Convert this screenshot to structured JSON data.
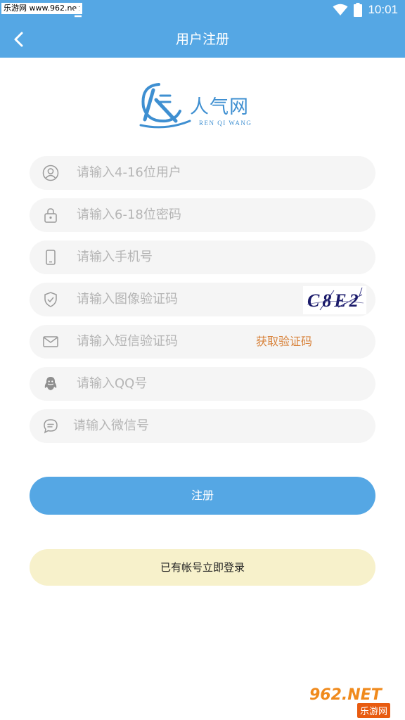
{
  "status_bar": {
    "watermark": "乐游网 www.962.net",
    "time": "10:01"
  },
  "header": {
    "title": "用户注册"
  },
  "logo": {
    "name": "人气网",
    "subtitle": "REN QI WANG"
  },
  "form": {
    "fields": [
      {
        "placeholder": "请输入4-16位用户",
        "icon": "user-icon"
      },
      {
        "placeholder": "请输入6-18位密码",
        "icon": "lock-icon"
      },
      {
        "placeholder": "请输入手机号",
        "icon": "phone-icon"
      },
      {
        "placeholder": "请输入图像验证码",
        "icon": "shield-icon"
      },
      {
        "placeholder": "请输入短信验证码",
        "icon": "mail-icon"
      },
      {
        "placeholder": "请输入QQ号",
        "icon": "qq-icon"
      },
      {
        "placeholder": "请输入微信号",
        "icon": "wechat-icon"
      }
    ],
    "captcha_text": "C8E2",
    "sms_button": "获取验证码"
  },
  "buttons": {
    "register": "注册",
    "login": "已有帐号立即登录"
  },
  "watermark_bottom": {
    "top": "962.NET",
    "bottom": "乐游网"
  },
  "colors": {
    "primary": "#55a7e4",
    "field_bg": "#f5f5f5",
    "login_bg": "#f7f1cb",
    "sms_text": "#d8823a"
  }
}
